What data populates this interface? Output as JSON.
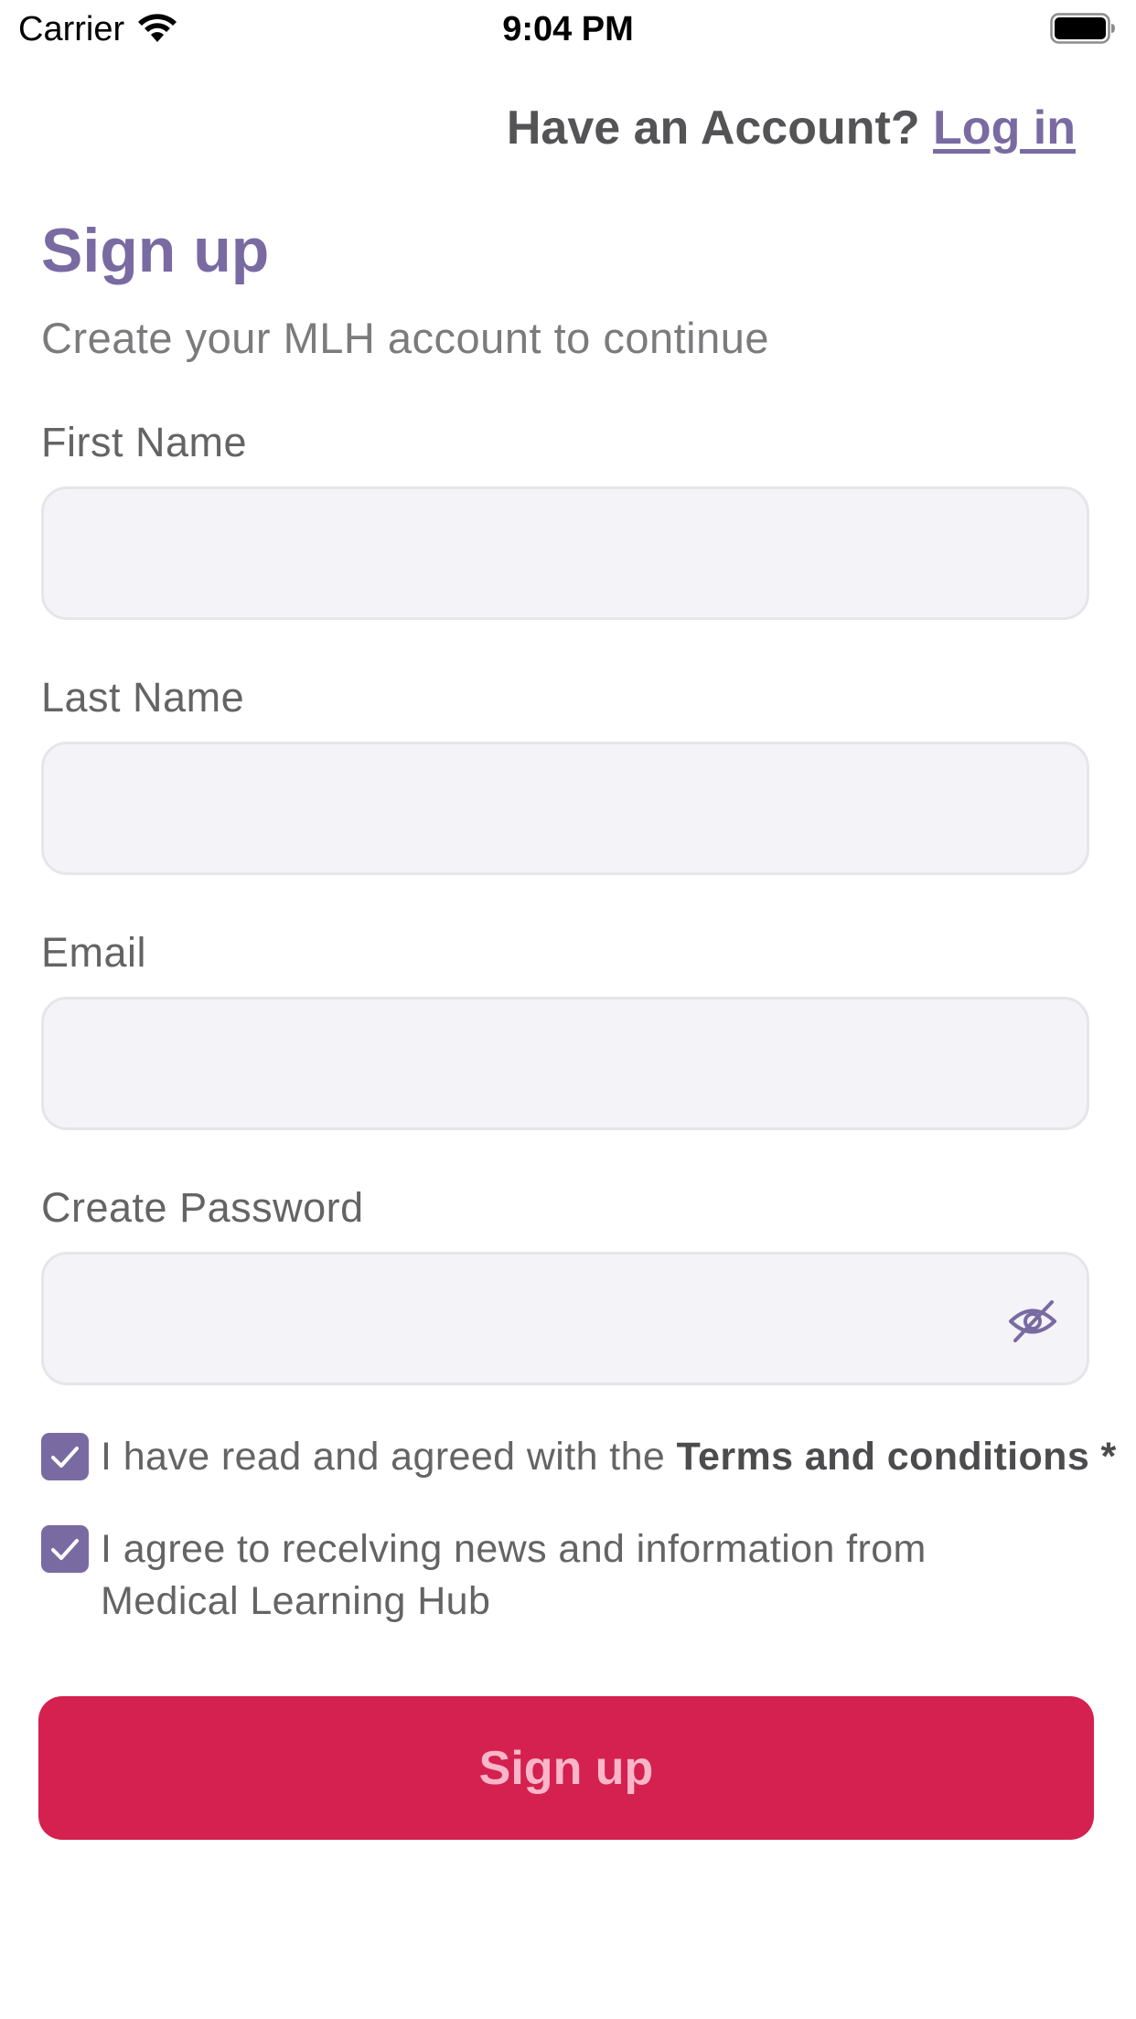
{
  "status_bar": {
    "carrier": "Carrier",
    "time": "9:04 PM",
    "icons": [
      "wifi-icon",
      "battery-icon"
    ]
  },
  "header": {
    "prompt": "Have an Account?",
    "login_link": "Log in"
  },
  "title": "Sign up",
  "subtitle": "Create your MLH account to continue",
  "fields": {
    "first_name": {
      "label": "First Name",
      "value": ""
    },
    "last_name": {
      "label": "Last Name",
      "value": ""
    },
    "email": {
      "label": "Email",
      "value": ""
    },
    "password": {
      "label": "Create Password",
      "value": "",
      "toggle_icon": "eye-slash-icon"
    }
  },
  "checkboxes": {
    "terms": {
      "checked": true,
      "text": "I have read and agreed with the",
      "link": "Terms and conditions",
      "required_mark": "*"
    },
    "news": {
      "checked": true,
      "text": "I agree to recelving news and information from Medical Learning Hub"
    }
  },
  "submit_button": "Sign up",
  "colors": {
    "accent_purple": "#7a6aa2",
    "button_red": "#d4214f",
    "button_text": "#f9b6c8",
    "field_bg": "#f4f3f8"
  }
}
